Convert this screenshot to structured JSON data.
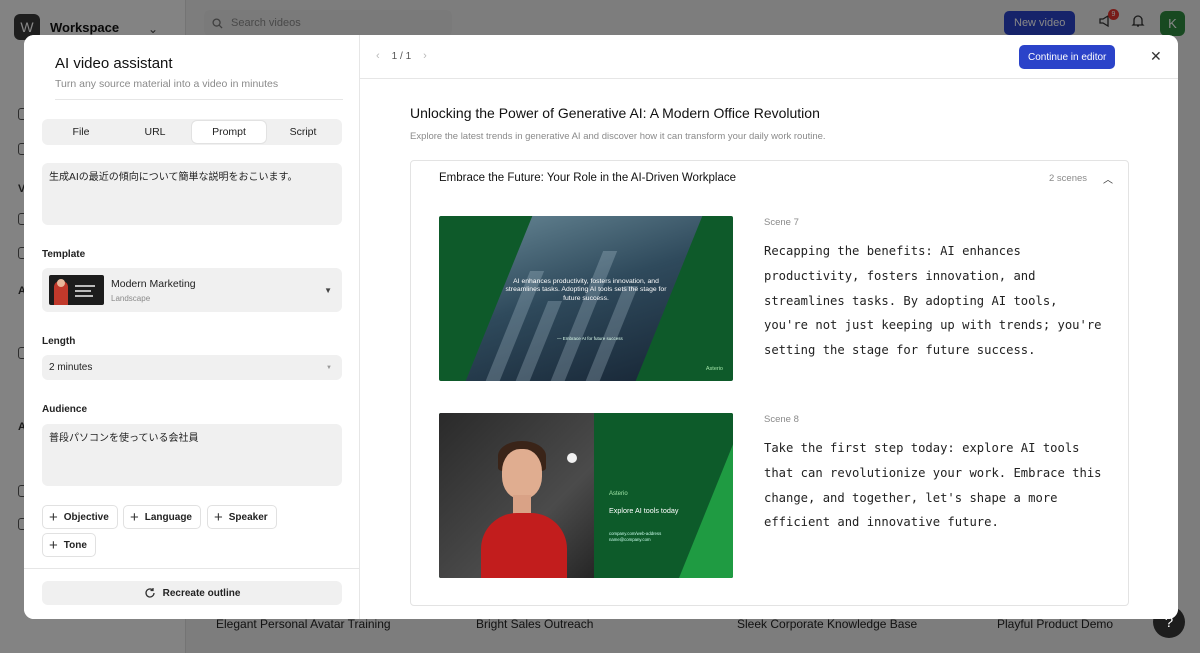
{
  "background_app": {
    "workspace_initial": "W",
    "workspace_name": "Workspace",
    "search_placeholder": "Search videos",
    "new_video_label": "New video",
    "notification_count": "9",
    "avatar_initial": "K",
    "sidebar_letters": [
      "V",
      "A",
      "A"
    ],
    "card_titles": [
      "Elegant Personal Avatar Training",
      "Bright Sales Outreach",
      "Sleek Corporate Knowledge Base",
      "Playful Product Demo"
    ],
    "help_label": "?"
  },
  "assistant": {
    "title": "AI video assistant",
    "subtitle": "Turn any source material into a video in minutes",
    "tabs": [
      {
        "label": "File"
      },
      {
        "label": "URL"
      },
      {
        "label": "Prompt",
        "active": true
      },
      {
        "label": "Script"
      }
    ],
    "prompt_value": "生成AIの最近の傾向について簡単な説明をおこいます。",
    "template_label": "Template",
    "template": {
      "name": "Modern Marketing",
      "orientation": "Landscape"
    },
    "length_label": "Length",
    "length_value": "2 minutes",
    "audience_label": "Audience",
    "audience_value": "普段パソコンを使っている会社員",
    "chips": [
      "Objective",
      "Language",
      "Speaker",
      "Tone"
    ],
    "recreate_label": "Recreate outline"
  },
  "preview": {
    "pager": "1 / 1",
    "continue_label": "Continue in editor",
    "title": "Unlocking the Power of Generative AI: A Modern Office Revolution",
    "subtitle": "Explore the latest trends in generative AI and discover how it can transform your daily work routine.",
    "section": {
      "title": "Embrace the Future: Your Role in the AI-Driven Workplace",
      "count": "2 scenes",
      "scenes": [
        {
          "label": "Scene 7",
          "script": "Recapping the benefits: AI enhances productivity, fosters innovation, and streamlines tasks. By adopting AI tools, you're not just keeping up with trends; you're setting the stage for future success.",
          "thumb_text": "AI enhances productivity, fosters innovation, and streamlines tasks. Adopting AI tools sets the stage for future success.",
          "thumb_small": "— Embrace AI for future success",
          "thumb_logo": "Asterio"
        },
        {
          "label": "Scene 8",
          "script": "Take the first step today: explore AI tools that can revolutionize your work. Embrace this change, and together, let's shape a more efficient and innovative future.",
          "thumb_logo": "Asterio",
          "thumb_title": "Explore AI tools today",
          "thumb_small": "company.com/web-address name@company.com"
        }
      ]
    }
  },
  "colors": {
    "accent": "#2b43c9",
    "scene_green": "#0e5a2a",
    "scene_bright_green": "#1f9b42",
    "badge_red": "#e3342f"
  }
}
